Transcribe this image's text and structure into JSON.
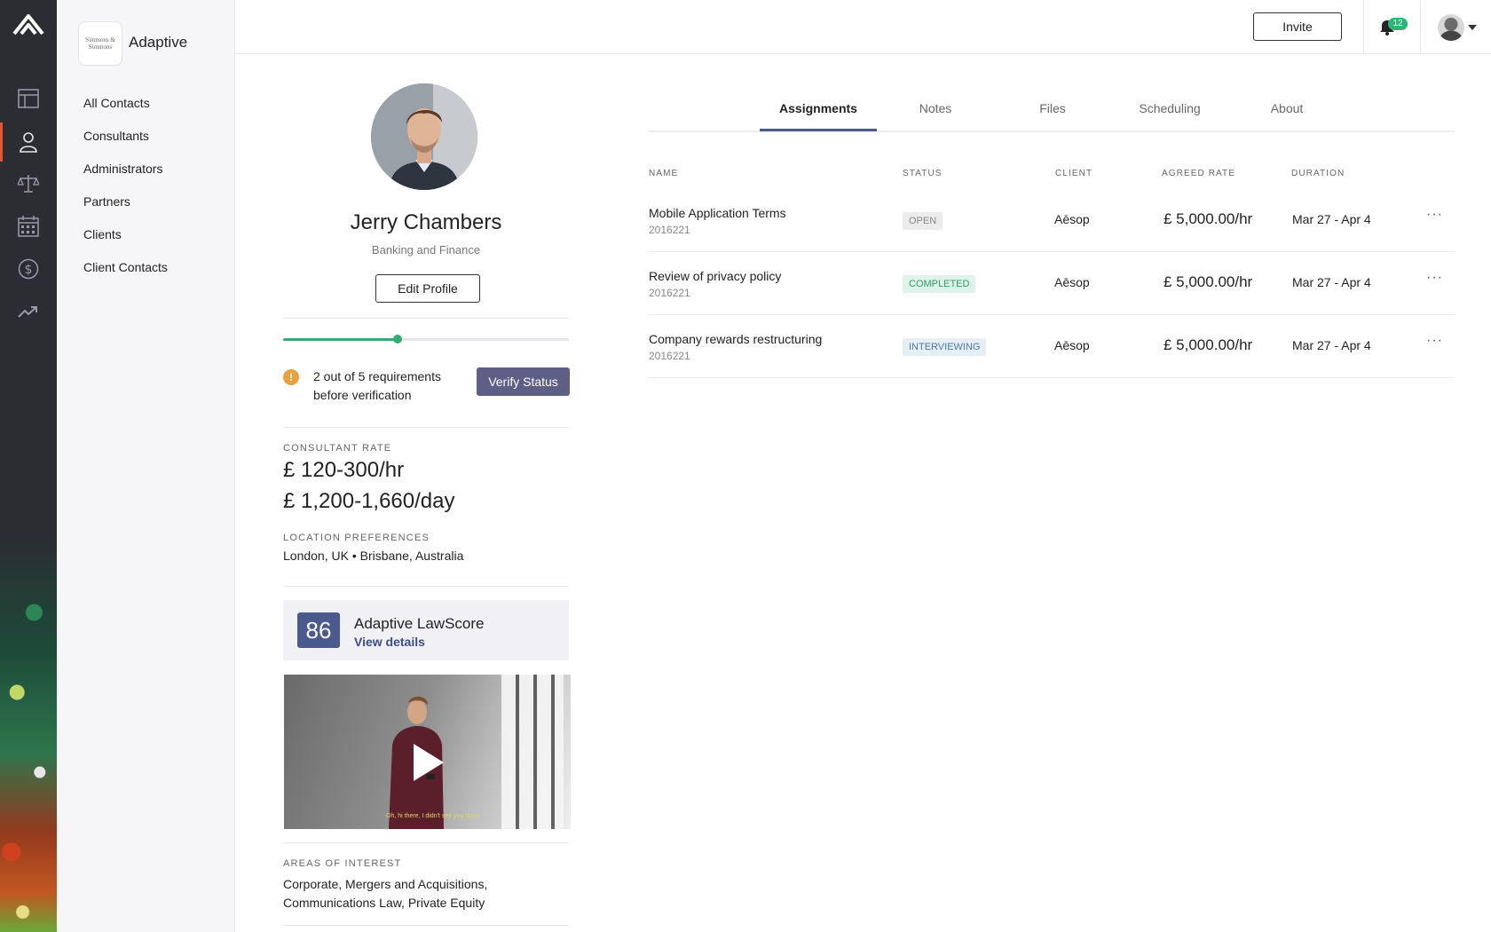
{
  "app": {
    "firm_logo_text": "Simmons & Simmons",
    "firm_name": "Adaptive"
  },
  "rail": {
    "icons": [
      "dashboard-icon",
      "contacts-icon",
      "scales-icon",
      "calendar-icon",
      "dollar-icon",
      "trending-icon"
    ],
    "active": "contacts-icon"
  },
  "sidebar": {
    "items": [
      {
        "label": "All Contacts"
      },
      {
        "label": "Consultants"
      },
      {
        "label": "Administrators"
      },
      {
        "label": "Partners"
      },
      {
        "label": "Clients"
      },
      {
        "label": "Client Contacts"
      }
    ]
  },
  "topbar": {
    "invite_label": "Invite",
    "notification_count": "12"
  },
  "profile": {
    "name": "Jerry Chambers",
    "practice_area": "Banking and Finance",
    "edit_label": "Edit Profile",
    "progress": 0.4,
    "requirements_text": "2 out of 5 requirements before verification",
    "warning_symbol": "!",
    "verify_label": "Verify Status",
    "rate_label": "CONSULTANT RATE",
    "rate_hourly": "£ 120-300/hr",
    "rate_daily": "£ 1,200-1,660/day",
    "location_label": "LOCATION PREFERENCES",
    "locations": "London, UK • Brisbane, Australia",
    "lawscore": {
      "value": "86",
      "title": "Adaptive LawScore",
      "link": "View details"
    },
    "video_caption": "Oh, hi there, I didn't see you there",
    "areas_label": "AREAS OF INTEREST",
    "areas": "Corporate, Mergers and Acquisitions, Communications Law, Private Equity"
  },
  "tabs": [
    {
      "label": "Assignments",
      "active": true
    },
    {
      "label": "Notes",
      "active": false
    },
    {
      "label": "Files",
      "active": false
    },
    {
      "label": "Scheduling",
      "active": false
    },
    {
      "label": "About",
      "active": false
    }
  ],
  "table": {
    "columns": [
      "NAME",
      "STATUS",
      "CLIENT",
      "AGREED RATE",
      "DURATION"
    ],
    "rows": [
      {
        "name": "Mobile Application Terms",
        "id": "2016221",
        "status": "OPEN",
        "client": "Aēsop",
        "rate": "£ 5,000.00/hr",
        "duration": "Mar 27 - Apr 4"
      },
      {
        "name": "Review of privacy policy",
        "id": "2016221",
        "status": "COMPLETED",
        "client": "Aēsop",
        "rate": "£ 5,000.00/hr",
        "duration": "Mar 27 - Apr 4"
      },
      {
        "name": "Company rewards restructuring",
        "id": "2016221",
        "status": "INTERVIEWING",
        "client": "Aēsop",
        "rate": "£ 5,000.00/hr",
        "duration": "Mar 27 - Apr 4"
      }
    ],
    "more_symbol": "···"
  },
  "colors": {
    "accent": "#4a5a8e",
    "status_open_bg": "#ececec",
    "status_open_fg": "#888888",
    "status_completed_bg": "#dff3ea",
    "status_completed_fg": "#2f9a6a",
    "status_interviewing_bg": "#e6eef6",
    "status_interviewing_fg": "#4e7aa6"
  }
}
